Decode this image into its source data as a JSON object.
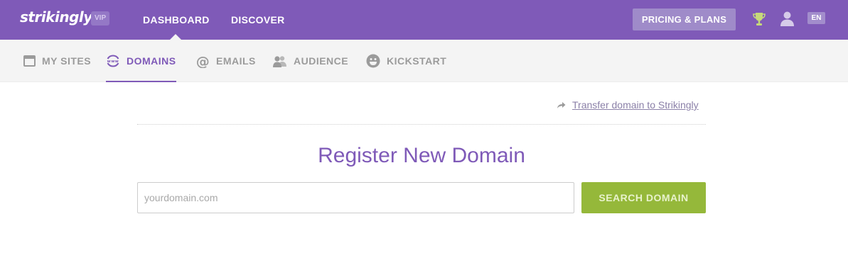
{
  "topbar": {
    "logo_text": "strikingly",
    "badge": "VIP",
    "nav": {
      "dashboard": "DASHBOARD",
      "discover": "DISCOVER"
    },
    "pricing_label": "PRICING & PLANS",
    "lang": "EN",
    "icons": [
      "trophy-icon",
      "user-icon"
    ]
  },
  "subnav": {
    "my_sites": "MY SITES",
    "domains": "DOMAINS",
    "emails": "EMAILS",
    "audience": "AUDIENCE",
    "kickstart": "KICKSTART",
    "active": "DOMAINS"
  },
  "main": {
    "transfer_link": "Transfer domain to Strikingly",
    "heading": "Register New Domain",
    "search": {
      "placeholder": "yourdomain.com",
      "value": ""
    },
    "search_button": "SEARCH DOMAIN"
  },
  "colors": {
    "brand_purple": "#7f5ab8",
    "pricing_bg": "#9f8bc9",
    "search_green": "#95b83a",
    "subnav_bg": "#f4f4f4"
  }
}
